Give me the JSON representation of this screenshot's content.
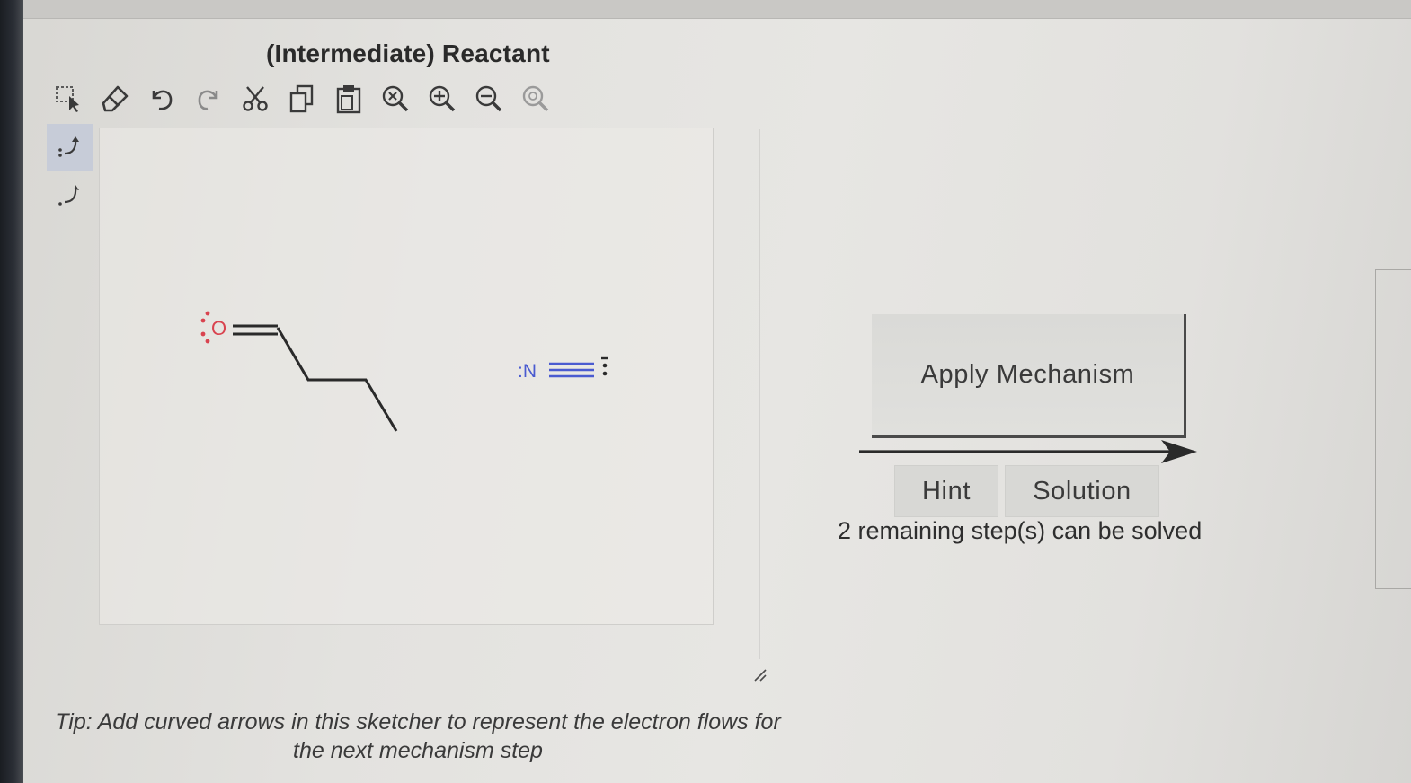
{
  "panel": {
    "title": "(Intermediate) Reactant"
  },
  "toolbar": {
    "tools": [
      {
        "name": "select-tool",
        "icon": "marquee-select-icon"
      },
      {
        "name": "erase-tool",
        "icon": "eraser-icon"
      },
      {
        "name": "undo-tool",
        "icon": "undo-icon"
      },
      {
        "name": "redo-tool",
        "icon": "redo-icon"
      },
      {
        "name": "cut-tool",
        "icon": "scissors-icon"
      },
      {
        "name": "copy-tool",
        "icon": "copy-icon"
      },
      {
        "name": "paste-tool",
        "icon": "paste-icon"
      },
      {
        "name": "zoom-reset-tool",
        "icon": "zoom-reset-icon"
      },
      {
        "name": "zoom-in-tool",
        "icon": "zoom-in-icon"
      },
      {
        "name": "zoom-out-tool",
        "icon": "zoom-out-icon"
      },
      {
        "name": "zoom-fit-tool",
        "icon": "zoom-fit-icon"
      }
    ]
  },
  "side_tools": [
    {
      "name": "electron-pair-arrow-tool",
      "icon": "curved-arrow-pair-icon",
      "active": true
    },
    {
      "name": "single-electron-arrow-tool",
      "icon": "curved-arrow-single-icon",
      "active": false
    }
  ],
  "molecule": {
    "oxygen_label": "O",
    "nitrogen_label": ":N",
    "colors": {
      "oxygen": "#d9434f",
      "nitrogen": "#4a5bd0",
      "bond": "#2a2a2a"
    }
  },
  "tip": {
    "lead": "Tip:",
    "text": " Add curved arrows in this sketcher to represent the electron flows for the next mechanism step"
  },
  "actions": {
    "apply_label": "Apply Mechanism",
    "hint_label": "Hint",
    "solution_label": "Solution",
    "status": "2 remaining step(s) can be solved"
  }
}
